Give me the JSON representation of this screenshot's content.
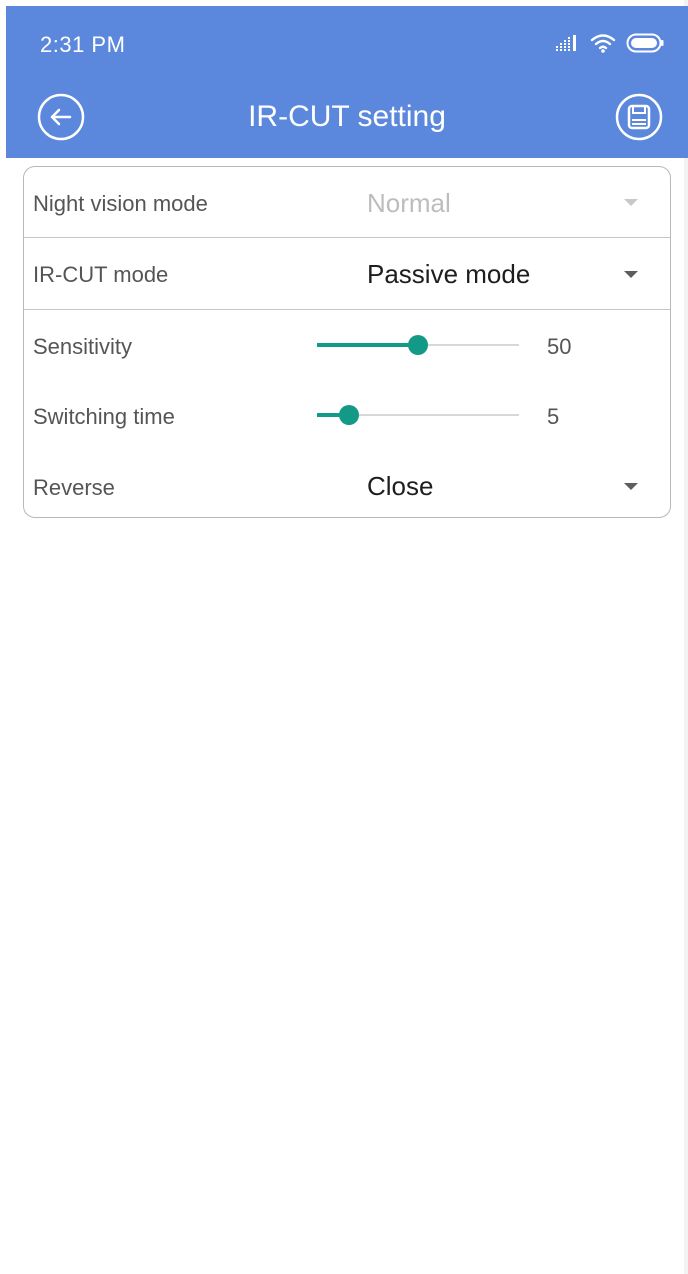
{
  "status_bar": {
    "time": "2:31 PM",
    "icons": [
      "signal-icon",
      "wifi-icon",
      "battery-icon"
    ]
  },
  "header": {
    "title": "IR-CUT setting",
    "back_icon": "back-arrow-icon",
    "save_icon": "save-icon",
    "background_color": "#5b88dd"
  },
  "settings": {
    "night_vision": {
      "label": "Night vision mode",
      "value": "Normal",
      "enabled": false
    },
    "ircut_mode": {
      "label": "IR-CUT mode",
      "value": "Passive mode"
    },
    "sensitivity": {
      "label": "Sensitivity",
      "value": "50",
      "level_fraction": 0.5
    },
    "switching_time": {
      "label": "Switching time",
      "value": "5",
      "level_fraction": 0.16
    },
    "reverse": {
      "label": "Reverse",
      "value": "Close"
    }
  },
  "colors": {
    "accent": "#139a86",
    "header": "#5b88dd"
  }
}
